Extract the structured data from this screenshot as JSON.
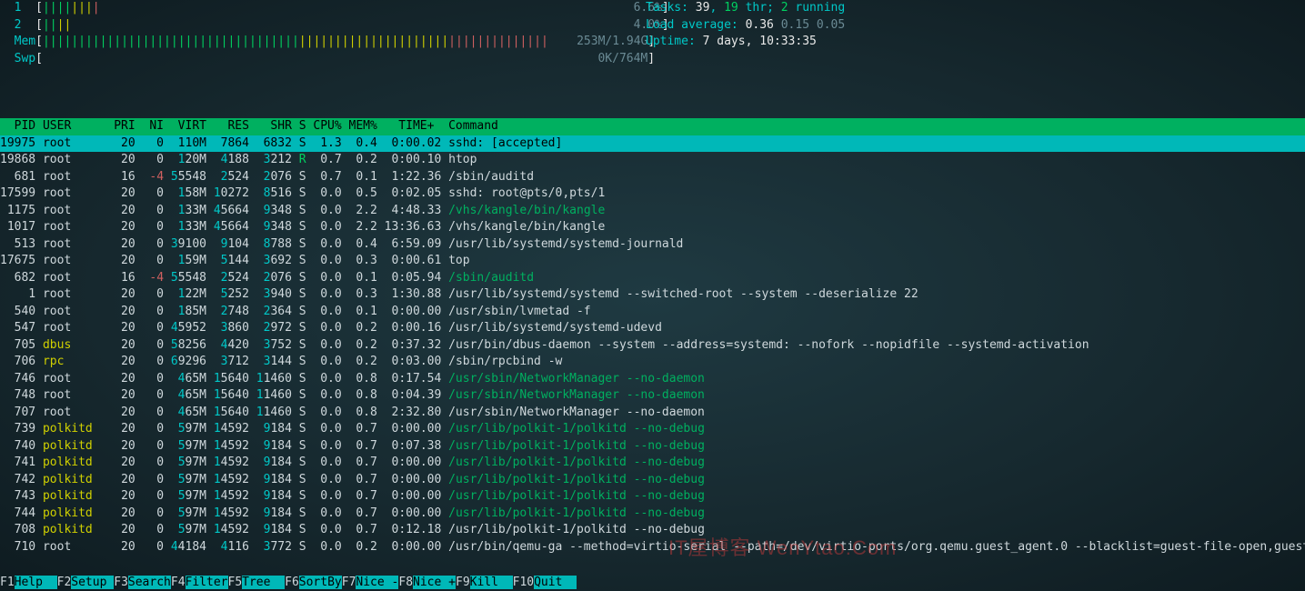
{
  "cpus": [
    {
      "label": "1",
      "bar": "[||||||||                                                                           6.6%]"
    },
    {
      "label": "2",
      "bar": "[||||                                                                               4.0%]"
    }
  ],
  "mem": {
    "label": "Mem",
    "bar": "[|||||||||||||||||||||||||||||||||||||||||||||||||||||||||||||||||||||||    253M/1.94G]"
  },
  "swp": {
    "label": "Swp",
    "bar": "[                                                                              0K/764M]"
  },
  "tasks": {
    "prefix": "Tasks: ",
    "total": "39",
    "mid": ", ",
    "thr": "19",
    "thr_lbl": " thr; ",
    "running": "2",
    "running_lbl": " running"
  },
  "load": {
    "prefix": "Load average: ",
    "v1": "0.36",
    "v2": "0.15",
    "v3": "0.05"
  },
  "uptime": {
    "prefix": "Uptime: ",
    "value": "7 days, 10:33:35"
  },
  "header": "  PID USER      PRI  NI  VIRT   RES   SHR S CPU% MEM%   TIME+  Command",
  "rows": [
    {
      "selected": true,
      "pid": "19975",
      "user": "root",
      "pri": "20",
      "ni": "0",
      "virt": "110M",
      "res": "7864",
      "shr": "6832",
      "s": "S",
      "cpu": "1.3",
      "mem": "0.4",
      "time": "0:00.02",
      "cmd": "sshd: [accepted]",
      "hl": false
    },
    {
      "pid": "19868",
      "user": "root",
      "pri": "20",
      "ni": "0",
      "virt": "120M",
      "res": "4188",
      "shr": "3212",
      "s": "R",
      "cpu": "0.7",
      "mem": "0.2",
      "time": "0:00.10",
      "cmd": "htop",
      "hl": false
    },
    {
      "pid": "681",
      "user": "root",
      "pri": "16",
      "ni": "-4",
      "ni_red": true,
      "virt": "55548",
      "res": "2524",
      "shr": "2076",
      "s": "S",
      "cpu": "0.7",
      "mem": "0.1",
      "time": "1:22.36",
      "cmd": "/sbin/auditd",
      "hl": false
    },
    {
      "pid": "17599",
      "user": "root",
      "pri": "20",
      "ni": "0",
      "virt": "158M",
      "res": "10272",
      "shr": "8516",
      "s": "S",
      "cpu": "0.0",
      "mem": "0.5",
      "time": "0:02.05",
      "cmd": "sshd: root@pts/0,pts/1",
      "hl": false
    },
    {
      "pid": "1175",
      "user": "root",
      "pri": "20",
      "ni": "0",
      "virt": "133M",
      "res": "45664",
      "shr": "9348",
      "s": "S",
      "cpu": "0.0",
      "mem": "2.2",
      "time": "4:48.33",
      "cmd": "/vhs/kangle/bin/kangle",
      "hl": true
    },
    {
      "pid": "1017",
      "user": "root",
      "pri": "20",
      "ni": "0",
      "virt": "133M",
      "res": "45664",
      "shr": "9348",
      "s": "S",
      "cpu": "0.0",
      "mem": "2.2",
      "time": "13:36.63",
      "cmd": "/vhs/kangle/bin/kangle",
      "hl": false
    },
    {
      "pid": "513",
      "user": "root",
      "pri": "20",
      "ni": "0",
      "virt": "39100",
      "res": "9104",
      "shr": "8788",
      "s": "S",
      "cpu": "0.0",
      "mem": "0.4",
      "time": "6:59.09",
      "cmd": "/usr/lib/systemd/systemd-journald",
      "hl": false
    },
    {
      "pid": "17675",
      "user": "root",
      "pri": "20",
      "ni": "0",
      "virt": "159M",
      "res": "5144",
      "shr": "3692",
      "s": "S",
      "cpu": "0.0",
      "mem": "0.3",
      "time": "0:00.61",
      "cmd": "top",
      "hl": false
    },
    {
      "pid": "682",
      "user": "root",
      "pri": "16",
      "ni": "-4",
      "ni_red": true,
      "virt": "55548",
      "res": "2524",
      "shr": "2076",
      "s": "S",
      "cpu": "0.0",
      "mem": "0.1",
      "time": "0:05.94",
      "cmd": "/sbin/auditd",
      "hl": true
    },
    {
      "pid": "1",
      "user": "root",
      "pri": "20",
      "ni": "0",
      "virt": "122M",
      "res": "5252",
      "shr": "3940",
      "s": "S",
      "cpu": "0.0",
      "mem": "0.3",
      "time": "1:30.88",
      "cmd": "/usr/lib/systemd/systemd --switched-root --system --deserialize 22",
      "hl": false
    },
    {
      "pid": "540",
      "user": "root",
      "pri": "20",
      "ni": "0",
      "virt": "185M",
      "res": "2748",
      "shr": "2364",
      "s": "S",
      "cpu": "0.0",
      "mem": "0.1",
      "time": "0:00.00",
      "cmd": "/usr/sbin/lvmetad -f",
      "hl": false
    },
    {
      "pid": "547",
      "user": "root",
      "pri": "20",
      "ni": "0",
      "virt": "45952",
      "res": "3860",
      "shr": "2972",
      "s": "S",
      "cpu": "0.0",
      "mem": "0.2",
      "time": "0:00.16",
      "cmd": "/usr/lib/systemd/systemd-udevd",
      "hl": false
    },
    {
      "pid": "705",
      "user": "dbus",
      "user_hl": true,
      "pri": "20",
      "ni": "0",
      "virt": "58256",
      "res": "4420",
      "shr": "3752",
      "s": "S",
      "cpu": "0.0",
      "mem": "0.2",
      "time": "0:37.32",
      "cmd": "/usr/bin/dbus-daemon --system --address=systemd: --nofork --nopidfile --systemd-activation",
      "hl": false
    },
    {
      "pid": "706",
      "user": "rpc",
      "user_hl": true,
      "pri": "20",
      "ni": "0",
      "virt": "69296",
      "res": "3712",
      "shr": "3144",
      "s": "S",
      "cpu": "0.0",
      "mem": "0.2",
      "time": "0:03.00",
      "cmd": "/sbin/rpcbind -w",
      "hl": false
    },
    {
      "pid": "746",
      "user": "root",
      "pri": "20",
      "ni": "0",
      "virt": "465M",
      "res": "15640",
      "shr": "11460",
      "s": "S",
      "cpu": "0.0",
      "mem": "0.8",
      "time": "0:17.54",
      "cmd": "/usr/sbin/NetworkManager --no-daemon",
      "hl": true
    },
    {
      "pid": "748",
      "user": "root",
      "pri": "20",
      "ni": "0",
      "virt": "465M",
      "res": "15640",
      "shr": "11460",
      "s": "S",
      "cpu": "0.0",
      "mem": "0.8",
      "time": "0:04.39",
      "cmd": "/usr/sbin/NetworkManager --no-daemon",
      "hl": true
    },
    {
      "pid": "707",
      "user": "root",
      "pri": "20",
      "ni": "0",
      "virt": "465M",
      "res": "15640",
      "shr": "11460",
      "s": "S",
      "cpu": "0.0",
      "mem": "0.8",
      "time": "2:32.80",
      "cmd": "/usr/sbin/NetworkManager --no-daemon",
      "hl": false
    },
    {
      "pid": "739",
      "user": "polkitd",
      "user_hl": true,
      "pri": "20",
      "ni": "0",
      "virt": "597M",
      "res": "14592",
      "shr": "9184",
      "s": "S",
      "cpu": "0.0",
      "mem": "0.7",
      "time": "0:00.00",
      "cmd": "/usr/lib/polkit-1/polkitd --no-debug",
      "hl": true
    },
    {
      "pid": "740",
      "user": "polkitd",
      "user_hl": true,
      "pri": "20",
      "ni": "0",
      "virt": "597M",
      "res": "14592",
      "shr": "9184",
      "s": "S",
      "cpu": "0.0",
      "mem": "0.7",
      "time": "0:07.38",
      "cmd": "/usr/lib/polkit-1/polkitd --no-debug",
      "hl": true
    },
    {
      "pid": "741",
      "user": "polkitd",
      "user_hl": true,
      "pri": "20",
      "ni": "0",
      "virt": "597M",
      "res": "14592",
      "shr": "9184",
      "s": "S",
      "cpu": "0.0",
      "mem": "0.7",
      "time": "0:00.00",
      "cmd": "/usr/lib/polkit-1/polkitd --no-debug",
      "hl": true
    },
    {
      "pid": "742",
      "user": "polkitd",
      "user_hl": true,
      "pri": "20",
      "ni": "0",
      "virt": "597M",
      "res": "14592",
      "shr": "9184",
      "s": "S",
      "cpu": "0.0",
      "mem": "0.7",
      "time": "0:00.00",
      "cmd": "/usr/lib/polkit-1/polkitd --no-debug",
      "hl": true
    },
    {
      "pid": "743",
      "user": "polkitd",
      "user_hl": true,
      "pri": "20",
      "ni": "0",
      "virt": "597M",
      "res": "14592",
      "shr": "9184",
      "s": "S",
      "cpu": "0.0",
      "mem": "0.7",
      "time": "0:00.00",
      "cmd": "/usr/lib/polkit-1/polkitd --no-debug",
      "hl": true
    },
    {
      "pid": "744",
      "user": "polkitd",
      "user_hl": true,
      "pri": "20",
      "ni": "0",
      "virt": "597M",
      "res": "14592",
      "shr": "9184",
      "s": "S",
      "cpu": "0.0",
      "mem": "0.7",
      "time": "0:00.00",
      "cmd": "/usr/lib/polkit-1/polkitd --no-debug",
      "hl": true
    },
    {
      "pid": "708",
      "user": "polkitd",
      "user_hl": true,
      "pri": "20",
      "ni": "0",
      "virt": "597M",
      "res": "14592",
      "shr": "9184",
      "s": "S",
      "cpu": "0.0",
      "mem": "0.7",
      "time": "0:12.18",
      "cmd": "/usr/lib/polkit-1/polkitd --no-debug",
      "hl": false
    },
    {
      "pid": "710",
      "user": "root",
      "pri": "20",
      "ni": "0",
      "virt": "44184",
      "res": "4116",
      "shr": "3772",
      "s": "S",
      "cpu": "0.0",
      "mem": "0.2",
      "time": "0:00.00",
      "cmd": "/usr/bin/qemu-ga --method=virtio-serial --path=/dev/virtio-ports/org.qemu.guest_agent.0 --blacklist=guest-file-open,guest-file-close,guest",
      "hl": false
    }
  ],
  "footer": [
    {
      "k": "F1",
      "l": "Help  "
    },
    {
      "k": "F2",
      "l": "Setup "
    },
    {
      "k": "F3",
      "l": "Search"
    },
    {
      "k": "F4",
      "l": "Filter"
    },
    {
      "k": "F5",
      "l": "Tree  "
    },
    {
      "k": "F6",
      "l": "SortBy"
    },
    {
      "k": "F7",
      "l": "Nice -"
    },
    {
      "k": "F8",
      "l": "Nice +"
    },
    {
      "k": "F9",
      "l": "Kill  "
    },
    {
      "k": "F10",
      "l": "Quit  "
    }
  ],
  "watermark": "IT屋博客 WenYtao.Com"
}
